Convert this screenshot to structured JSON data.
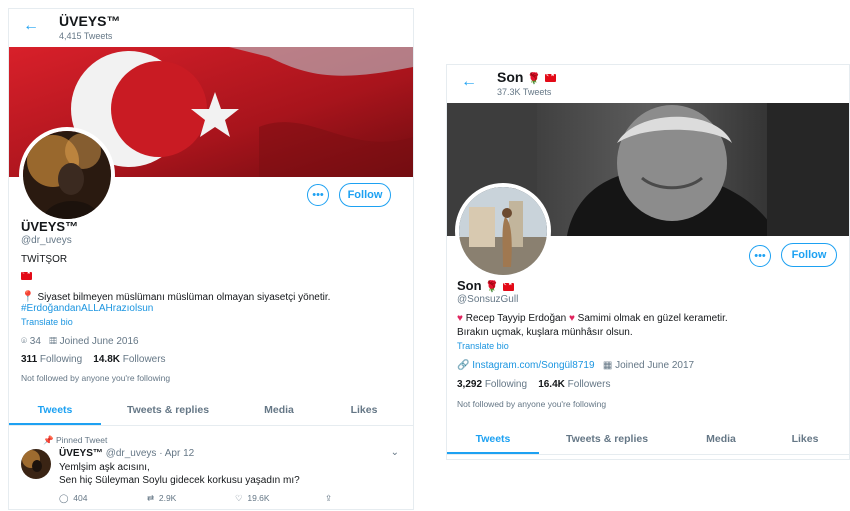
{
  "left": {
    "header": {
      "name": "ÜVEYS™",
      "tweet_count": "4,415 Tweets"
    },
    "profile": {
      "display_name": "ÜVEYS™",
      "handle": "@dr_uveys",
      "bio_line1": "TWİTŞOR",
      "bio_line2": "Siyaset bilmeyen müslümanı müslüman olmayan siyasetçi yönetir.",
      "hashtag": "#ErdoğandanALLAHrazıolsun",
      "translate": "Translate bio",
      "location": "34",
      "joined": "Joined June 2016",
      "following_count": "311",
      "following_label": "Following",
      "followers_count": "14.8K",
      "followers_label": "Followers",
      "not_followed": "Not followed by anyone you're following"
    },
    "buttons": {
      "more": "•••",
      "follow": "Follow"
    },
    "tabs": [
      "Tweets",
      "Tweets & replies",
      "Media",
      "Likes"
    ],
    "tweet": {
      "pinned_label": "Pinned Tweet",
      "author": "ÜVEYS™",
      "handle_date": "@dr_uveys · Apr 12",
      "line1": "Yemlşim aşk acısını,",
      "line2": "Sen hiç Süleyman Soylu gidecek korkusu yaşadın mı?",
      "replies": "404",
      "retweets": "2.9K",
      "likes": "19.6K"
    }
  },
  "right": {
    "header": {
      "name": "Son",
      "tweet_count": "37.3K Tweets"
    },
    "profile": {
      "display_name": "Son",
      "handle": "@SonsuzGull",
      "bio_name": "Recep Tayyip Erdoğan",
      "bio_rest": "Samimi olmak en güzel kerametir.",
      "bio_line2": "Bırakın uçmak, kuşlara münhâsır olsun.",
      "translate": "Translate bio",
      "website": "Instagram.com/Songül8719",
      "joined": "Joined June 2017",
      "following_count": "3,292",
      "following_label": "Following",
      "followers_count": "16.4K",
      "followers_label": "Followers",
      "not_followed": "Not followed by anyone you're following"
    },
    "buttons": {
      "more": "•••",
      "follow": "Follow"
    },
    "tabs": [
      "Tweets",
      "Tweets & replies",
      "Media",
      "Likes"
    ]
  },
  "icons": {
    "back": "back-arrow-icon",
    "flag": "turkey-flag-icon",
    "rose": "rose-icon",
    "heart": "heart-icon",
    "pin": "pin-icon",
    "location": "location-icon",
    "calendar": "calendar-icon",
    "link": "link-icon",
    "reply": "reply-icon",
    "retweet": "retweet-icon",
    "like": "like-icon",
    "share": "share-icon",
    "chevron": "chevron-down-icon"
  },
  "colors": {
    "accent": "#1da1f2",
    "link": "#1b95e0",
    "flag_red": "#e30a17",
    "heart": "#e0245e"
  }
}
